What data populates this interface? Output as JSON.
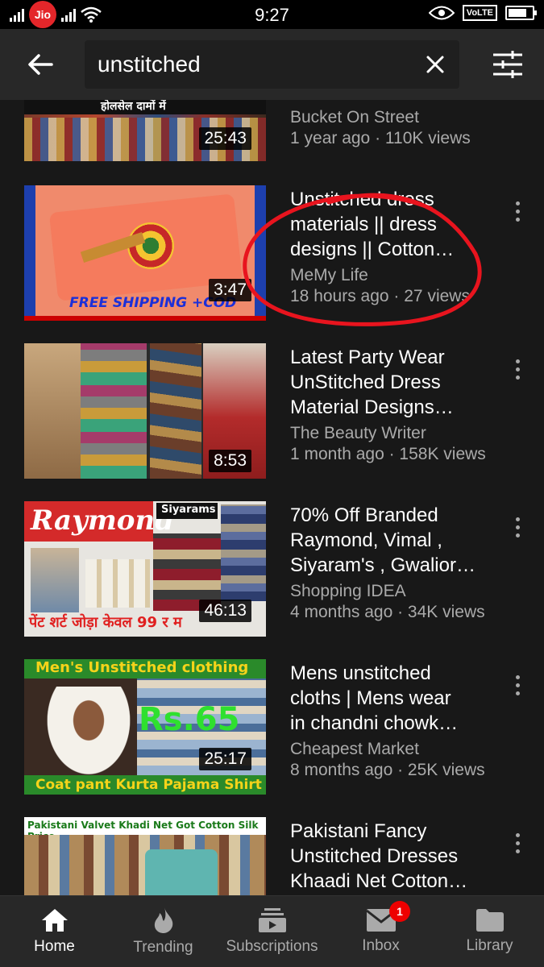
{
  "status_bar": {
    "carrier": "Jio",
    "time": "9:27",
    "volte": "VoLTE"
  },
  "search": {
    "query": "unstitched"
  },
  "results": [
    {
      "title_lines": [],
      "channel": "Bucket On Street",
      "stats": "1 year ago · 110K views",
      "duration": "25:43",
      "thumb_text": "होलसेल दामों में"
    },
    {
      "title_lines": [
        "Unstitched dress",
        "materials || dress",
        "designs || Cotton…"
      ],
      "channel": "MeMy Life",
      "stats": "18 hours ago · 27 views",
      "duration": "3:47",
      "thumb_text": "FREE SHIPPING +COD"
    },
    {
      "title_lines": [
        "Latest Party Wear",
        "UnStitched Dress",
        "Material Designs…"
      ],
      "channel": "The Beauty Writer",
      "stats": "1 month ago · 158K views",
      "duration": "8:53"
    },
    {
      "title_lines": [
        "70% Off Branded",
        "Raymond, Vimal ,",
        "Siyaram's , Gwalior…"
      ],
      "channel": "Shopping IDEA",
      "stats": "4 months ago · 34K views",
      "duration": "46:13",
      "thumb_text": "Raymond",
      "thumb_text2": "Siyarams",
      "thumb_text3": "पेंट शर्ट जोड़ा केवल 99 र म"
    },
    {
      "title_lines": [
        "Mens unstitched",
        "cloths | Mens wear",
        "in chandni chowk…"
      ],
      "channel": "Cheapest Market",
      "stats": "8 months ago · 25K views",
      "duration": "25:17",
      "thumb_text": "Men's Unstitched clothing",
      "thumb_text2": "Rs.65",
      "thumb_text3": "Coat pant Kurta Pajama Shirt"
    },
    {
      "title_lines": [
        "Pakistani Fancy",
        "Unstitched Dresses",
        "Khaadi Net Cotton…"
      ],
      "thumb_text": "Pakistani Valvet Khadi Net Got Cotton Silk Price"
    }
  ],
  "bottom_nav": [
    {
      "label": "Home",
      "icon": "home-icon",
      "active": true
    },
    {
      "label": "Trending",
      "icon": "flame-icon"
    },
    {
      "label": "Subscriptions",
      "icon": "subscriptions-icon"
    },
    {
      "label": "Inbox",
      "icon": "inbox-icon",
      "badge": "1"
    },
    {
      "label": "Library",
      "icon": "folder-icon"
    }
  ],
  "colors": {
    "brand_red": "#e00000",
    "background": "#181818",
    "header": "#282828",
    "secondary_text": "#aaaaaa",
    "annotation": "#e8141e"
  }
}
